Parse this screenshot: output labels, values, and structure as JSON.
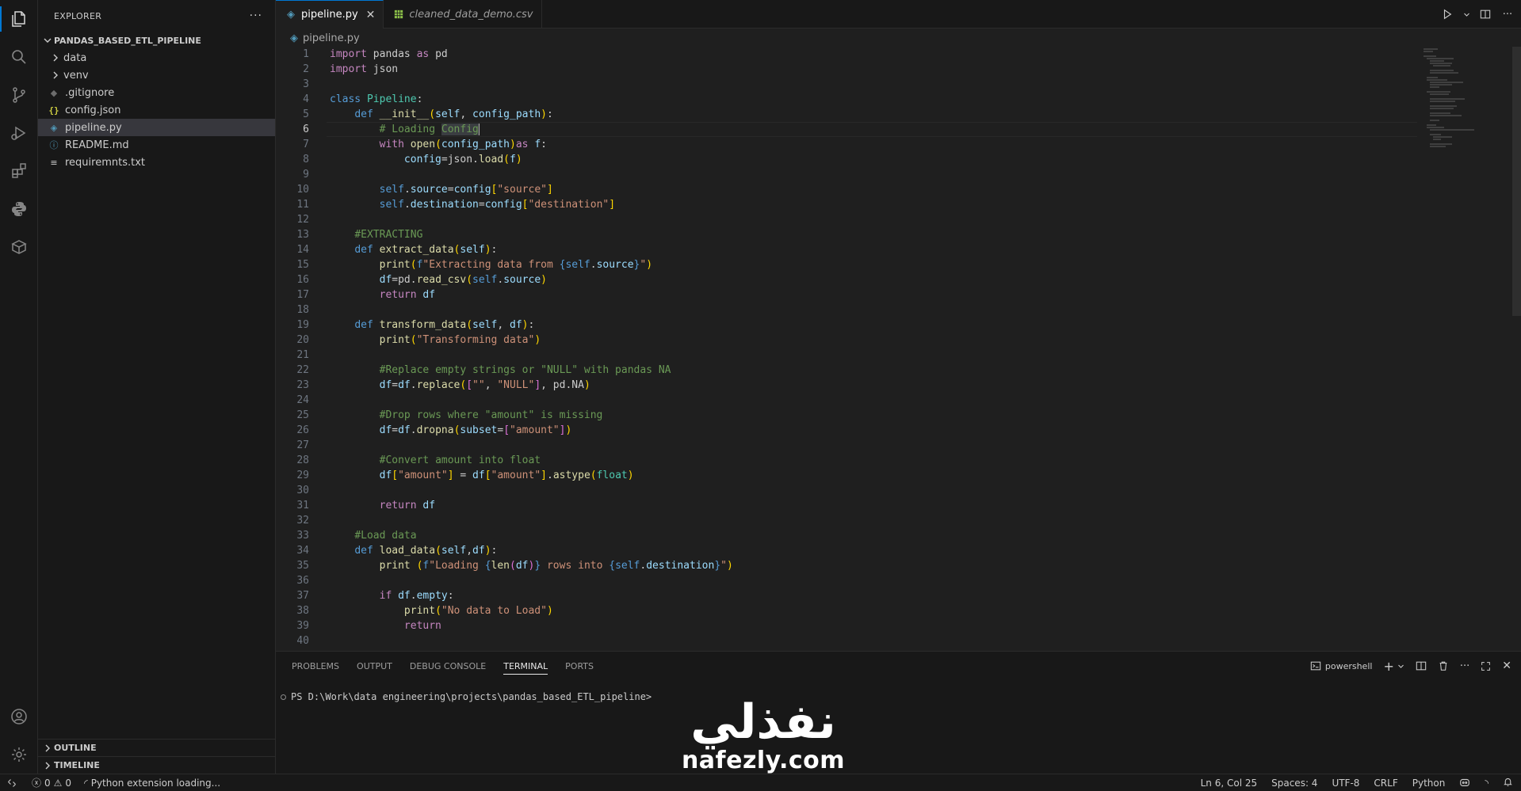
{
  "sidebar": {
    "title": "EXPLORER",
    "more": "···",
    "project": "PANDAS_BASED_ETL_PIPELINE",
    "items": [
      {
        "label": "data",
        "type": "folder"
      },
      {
        "label": "venv",
        "type": "folder"
      },
      {
        "label": ".gitignore",
        "type": "file",
        "icon": "git-icon"
      },
      {
        "label": "config.json",
        "type": "file",
        "icon": "json-icon"
      },
      {
        "label": "pipeline.py",
        "type": "file",
        "icon": "python-icon",
        "selected": true
      },
      {
        "label": "README.md",
        "type": "file",
        "icon": "info-icon"
      },
      {
        "label": "requiremnts.txt",
        "type": "file",
        "icon": "text-file-icon"
      }
    ],
    "outline": "OUTLINE",
    "timeline": "TIMELINE"
  },
  "tabs": [
    {
      "label": "pipeline.py",
      "close": "✕"
    },
    {
      "label": "cleaned_data_demo.csv"
    }
  ],
  "breadcrumb": "pipeline.py",
  "editor": {
    "current_line": 6
  },
  "panel": {
    "tabs": [
      "PROBLEMS",
      "OUTPUT",
      "DEBUG CONSOLE",
      "TERMINAL",
      "PORTS"
    ],
    "active_tab": "TERMINAL",
    "shell": "powershell",
    "prompt": "PS D:\\Work\\data engineering\\projects\\pandas_based_ETL_pipeline>"
  },
  "watermark": {
    "arabic": "نفذلي",
    "latin": "nafezly.com"
  },
  "status": {
    "errors": "0",
    "warnings": "0",
    "message": "Python extension loading...",
    "position": "Ln 6, Col 25",
    "spaces": "Spaces: 4",
    "encoding": "UTF-8",
    "eol": "CRLF",
    "language": "Python"
  },
  "colors": {
    "accent": "#0078d4",
    "background": "#1f1f1f",
    "sidebar": "#181818"
  }
}
